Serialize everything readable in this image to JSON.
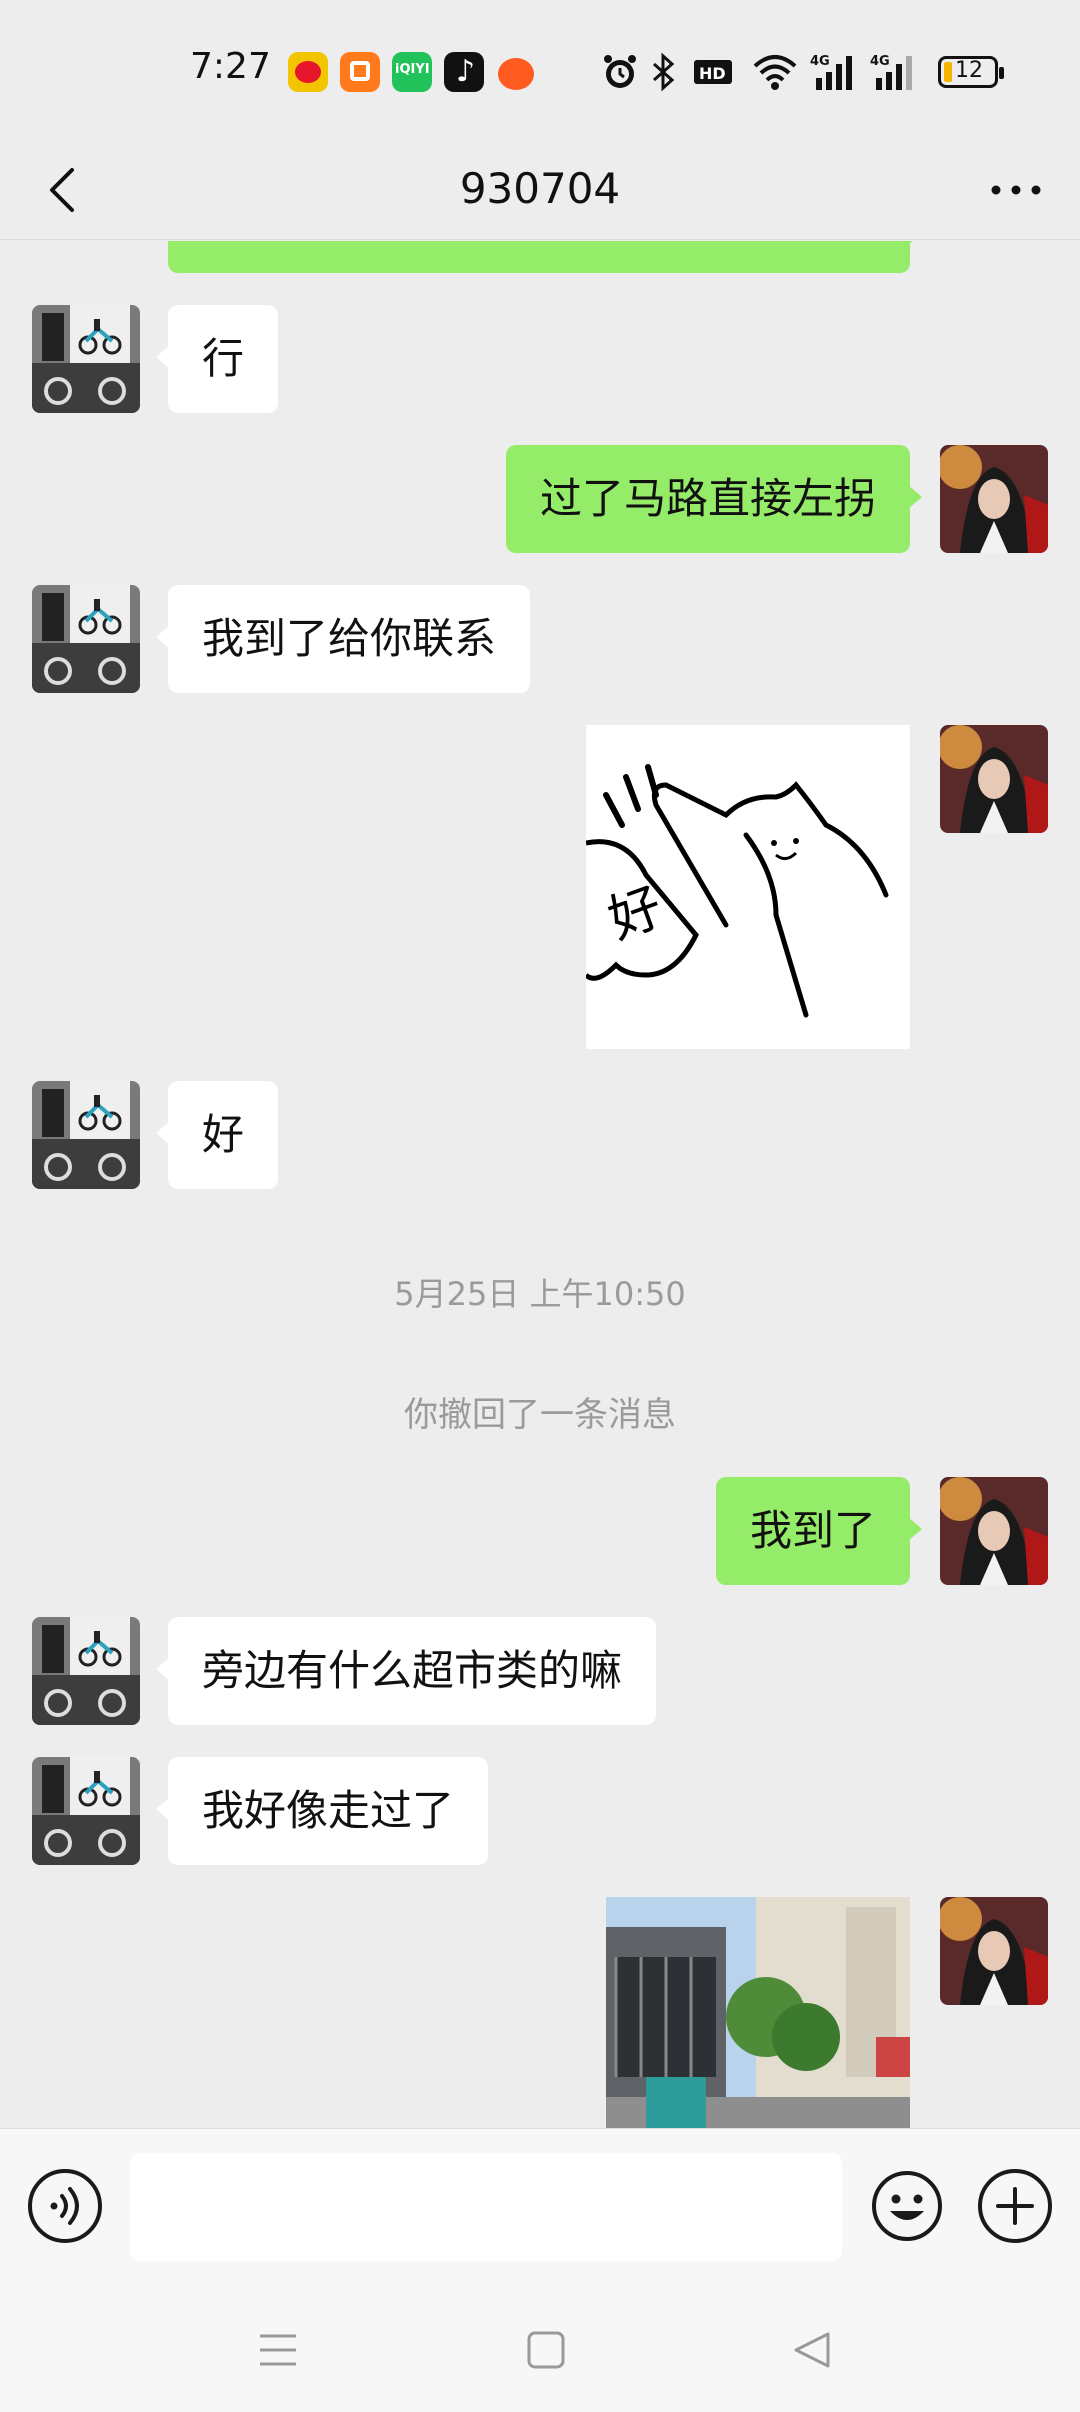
{
  "status_bar": {
    "time": "7:27",
    "battery": "12",
    "apps": [
      "weibo-icon",
      "kuaishou-icon",
      "iqiyi-icon",
      "tiktok-icon",
      "pumpkin-app-icon"
    ],
    "system_icons": [
      "alarm-icon",
      "bluetooth-icon",
      "hd-icon",
      "wifi-icon",
      "signal-4g-icon",
      "signal-4g-icon-2"
    ]
  },
  "header": {
    "title": "930704"
  },
  "messages": [
    {
      "side": "in",
      "text": "行"
    },
    {
      "side": "out",
      "text": "过了马路直接左拐"
    },
    {
      "side": "in",
      "text": "我到了给你联系"
    },
    {
      "side": "out",
      "type": "sticker",
      "sticker_text": "好"
    },
    {
      "side": "in",
      "text": "好"
    },
    {
      "side": "out",
      "text": "我到了"
    },
    {
      "side": "in",
      "text": "旁边有什么超市类的嘛"
    },
    {
      "side": "in",
      "text": "我好像走过了"
    },
    {
      "side": "out",
      "type": "image"
    }
  ],
  "system_messages": {
    "timestamp": "5月25日 上午10:50",
    "recall_notice": "你撤回了一条消息"
  },
  "input": {
    "value": "",
    "placeholder": ""
  },
  "colors": {
    "outgoing_bubble": "#95ec69",
    "incoming_bubble": "#ffffff",
    "background": "#ededed"
  }
}
